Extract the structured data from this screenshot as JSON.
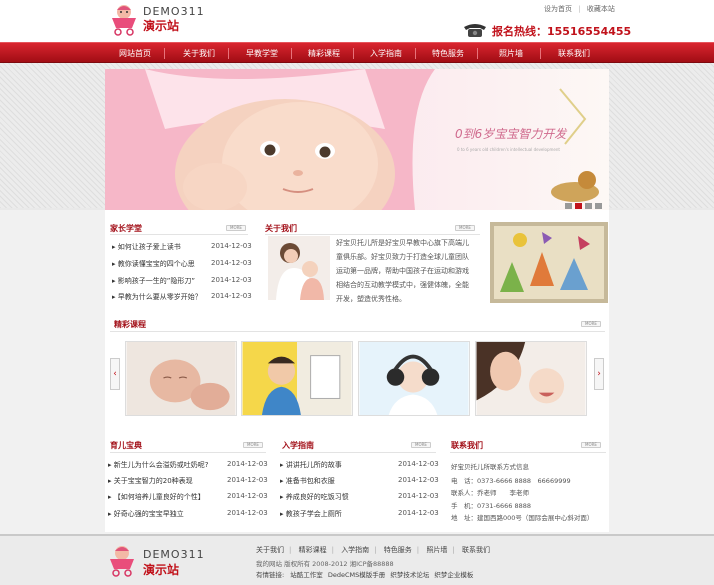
{
  "header": {
    "logo_en": "DEMO311",
    "logo_cn": "演示站",
    "top_links": [
      "设为首页",
      "收藏本站"
    ],
    "hotline": "报名热线：15516554455"
  },
  "nav": [
    "网站首页",
    "关于我们",
    "早教学堂",
    "精彩课程",
    "入学指南",
    "特色服务",
    "照片墙",
    "联系我们"
  ],
  "banner": {
    "headline": "0到6岁宝宝智力开发",
    "sub": "0 to 6 years old children's intellectual development"
  },
  "parent_school": {
    "title": "家长学堂",
    "more": "MORE",
    "items": [
      {
        "text": "如何让孩子爱上读书",
        "date": "2014-12-03"
      },
      {
        "text": "教你读懂宝宝的四个心思",
        "date": "2014-12-03"
      },
      {
        "text": "影响孩子一生的”隐形刀”",
        "date": "2014-12-03"
      },
      {
        "text": "早教为什么要从零岁开始？",
        "date": "2014-12-03"
      }
    ]
  },
  "about": {
    "title": "关于我们",
    "more": "MORE",
    "text": "好宝贝托儿所是好宝贝早教中心旗下高端儿童俱乐部。好宝贝致力于打造全球儿童团队运动第一品牌，帮助中国孩子在运动和游戏相结合的互动教学模式中，强健体魄，全能开发，塑造优秀性格。"
  },
  "courses": {
    "title": "精彩课程",
    "more": "MORE",
    "prev": "‹",
    "next": "›"
  },
  "parenting": {
    "title": "育儿宝典",
    "more": "MORE",
    "items": [
      {
        "text": "新生儿为什么会溢奶或吐奶呢?",
        "date": "2014-12-03"
      },
      {
        "text": "关于宝宝智力的20种表现",
        "date": "2014-12-03"
      },
      {
        "text": "【如何培养儿童良好的个性】",
        "date": "2014-12-03"
      },
      {
        "text": "好奇心强的宝宝早独立",
        "date": "2014-12-03"
      }
    ]
  },
  "admission": {
    "title": "入学指南",
    "more": "MORE",
    "items": [
      {
        "text": "讲讲托儿所的故事",
        "date": "2014-12-03"
      },
      {
        "text": "准备书包和衣服",
        "date": "2014-12-03"
      },
      {
        "text": "养成良好的吃饭习惯",
        "date": "2014-12-03"
      },
      {
        "text": "教孩子学会上厕所",
        "date": "2014-12-03"
      }
    ]
  },
  "contact": {
    "title": "联系我们",
    "more": "MORE",
    "lines": [
      "好宝贝托儿所联系方式信息",
      "电　话：0373-6666 8888　66669999",
      "联系人：乔老师　　李老师",
      "手　机：0731-6666 8888",
      "地　址：建国西路000号（国际会展中心斜对面）"
    ]
  },
  "footer": {
    "logo_en": "DEMO311",
    "logo_cn": "演示站",
    "links": [
      "关于我们",
      "精彩课程",
      "入学指南",
      "特色服务",
      "照片墙",
      "联系我们"
    ],
    "copyright": "我的网站 版权所有 2008-2012 湘ICP备88888",
    "friend_label": "有情链接:",
    "friend_links": [
      "站酷工作室",
      "DedeCMS模版手册",
      "织梦技术论坛",
      "织梦企业模板"
    ]
  }
}
